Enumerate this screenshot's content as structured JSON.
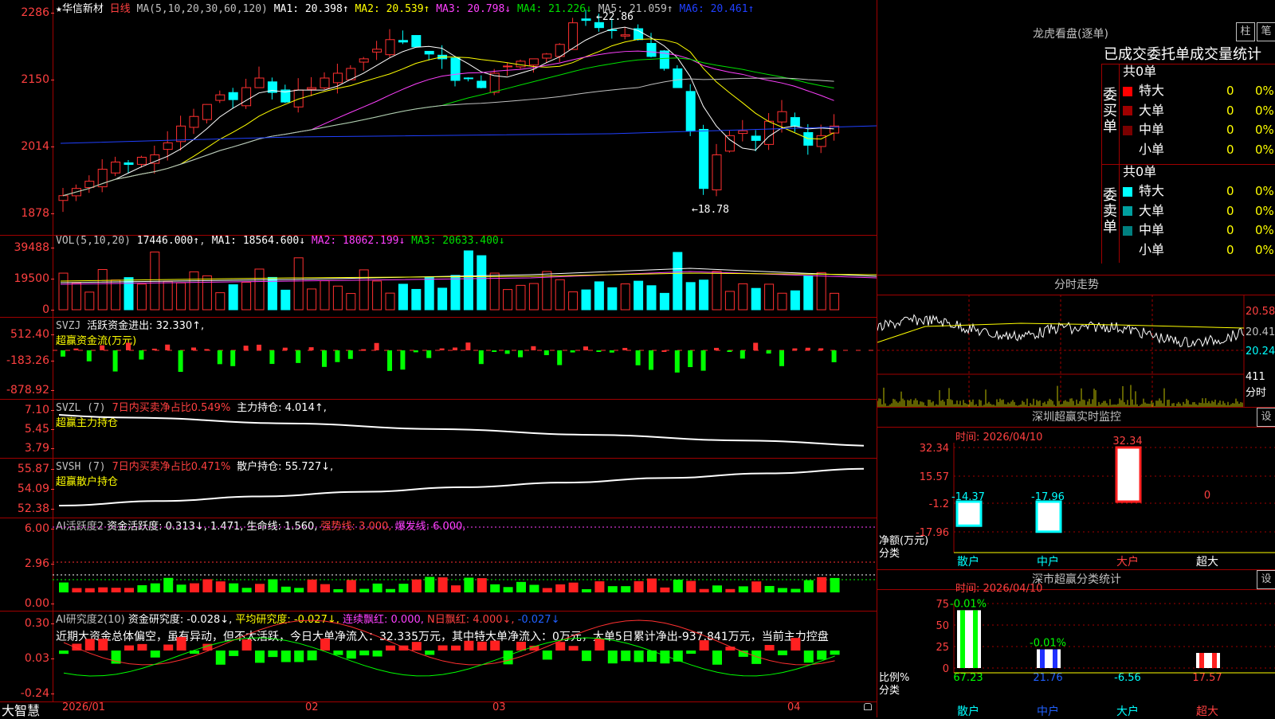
{
  "main": {
    "star": "★",
    "stock_name": "华信新材",
    "period": "日线",
    "ma_label": "MA(5,10,20,30,60,120)",
    "ma_items": [
      {
        "label": "MA1: 20.398↑",
        "color": "#ffffff"
      },
      {
        "label": "MA2: 20.539↑",
        "color": "#ffff00"
      },
      {
        "label": "MA3: 20.798↓",
        "color": "#ff40ff"
      },
      {
        "label": "MA4: 21.226↓",
        "color": "#00e000"
      },
      {
        "label": "MA5: 21.059↑",
        "color": "#c0c0c0"
      },
      {
        "label": "MA6: 20.461↑",
        "color": "#2040ff"
      }
    ],
    "y_labels": [
      "2286",
      "2150",
      "2014",
      "1878"
    ],
    "high_label": "22.86",
    "low_label": "18.78",
    "colors": {
      "up": "#ff3030",
      "down": "#00ffff"
    }
  },
  "vol": {
    "title": "VOL(5,10,20)",
    "value": "17446.000↑",
    "items": [
      {
        "label": "MA1: 18564.600↓",
        "color": "#ffffff"
      },
      {
        "label": "MA2: 18062.199↓",
        "color": "#ff40ff"
      },
      {
        "label": "MA3: 20633.400↓",
        "color": "#00e000"
      }
    ],
    "y_labels": [
      "39488",
      "19500",
      "0"
    ]
  },
  "svzj": {
    "title": "SVZJ",
    "line1": "活跃资金进出: 32.330↑,",
    "line2": "超赢资金流(万元)",
    "y_labels": [
      "512.40",
      "-183.26",
      "-878.92"
    ]
  },
  "svzl": {
    "title": "SVZL (7)",
    "t1": "7日内买卖净占比0.549%",
    "t2": "主力持仓: 4.014↑,",
    "line2": "超赢主力持仓",
    "y_labels": [
      "7.10",
      "5.45",
      "3.79"
    ]
  },
  "svsh": {
    "title": "SVSH (7)",
    "t1": "7日内买卖净占比0.471%",
    "t2": "散户持仓: 55.727↓,",
    "line2": "超赢散户持仓",
    "y_labels": [
      "55.87",
      "54.09",
      "52.38"
    ]
  },
  "ai1": {
    "title": "AI活跃度2",
    "t1": "资金活跃度: 0.313↓, 1.471,",
    "t2": "生命线: 1.560,",
    "t3": "强势线: 3.000,",
    "t4": "爆发线: 6.000,",
    "y_labels": [
      "6.00",
      "2.96",
      "0.00"
    ]
  },
  "ai2": {
    "title": "AI研究度2(10)",
    "t1": "资金研究度: -0.028↓,",
    "t2": "平均研究度: -0.027↓,",
    "t3": "连续飘红: 0.000,",
    "t4": "N日飘红: 4.000↓,",
    "t5": "-0.027↓",
    "comment": "近期大资金总体偏空，虽有异动，但不太活跃，今日大单净流入：32.335万元，其中特大单净流入：0万元，大单5日累计净出-937.841万元，当前主力控盘",
    "y_labels": [
      "0.30",
      "0.03",
      "-0.24"
    ]
  },
  "bottom": {
    "brand": "大智慧",
    "dates": [
      "2026/01",
      "02",
      "03",
      "04"
    ]
  },
  "dragon": {
    "title": "龙虎看盘(逐单)",
    "btn1": "柱",
    "btn2": "笔",
    "subtitle": "已成交委托单成交量统计",
    "buy_label": "委买单",
    "sell_label": "委卖单",
    "buy_total": "共0单",
    "sell_total": "共0单",
    "buy_rows": [
      {
        "name": "特大",
        "v": "0",
        "p": "0%",
        "color": "#ff0000"
      },
      {
        "name": "大单",
        "v": "0",
        "p": "0%",
        "color": "#a00000"
      },
      {
        "name": "中单",
        "v": "0",
        "p": "0%",
        "color": "#7a0000"
      },
      {
        "name": "小单",
        "v": "0",
        "p": "0%",
        "color": "#000000"
      }
    ],
    "sell_rows": [
      {
        "name": "特大",
        "v": "0",
        "p": "0%",
        "color": "#00ffff"
      },
      {
        "name": "大单",
        "v": "0",
        "p": "0%",
        "color": "#00a0a0"
      },
      {
        "name": "中单",
        "v": "0",
        "p": "0%",
        "color": "#008080"
      },
      {
        "name": "小单",
        "v": "0",
        "p": "0%",
        "color": "#000000"
      }
    ]
  },
  "intraday": {
    "title": "分时走势",
    "labels": [
      "20.58",
      "20.41",
      "20.24"
    ],
    "vol_label": "411",
    "sub_label": "分时"
  },
  "monitor": {
    "title": "深圳超赢实时监控",
    "btn": "设",
    "date": "时间: 2026/04/10",
    "y_labels": [
      "32.34",
      "15.57",
      "-1.2",
      "-17.96"
    ],
    "bar_labels": [
      "-14.37",
      "-17.96",
      "32.34",
      "0"
    ],
    "categories": [
      "散户",
      "中户",
      "大户",
      "超大"
    ],
    "unit": "净额(万元)",
    "cat_label": "分类"
  },
  "classify": {
    "title": "深市超赢分类统计",
    "btn": "设",
    "date": "时间: 2026/04/10",
    "y_labels": [
      "75",
      "50",
      "25",
      "0"
    ],
    "top_labels": [
      "-0.01%",
      "-0.01%"
    ],
    "bottom_values": [
      "67.23",
      "21.76",
      "-6.56",
      "17.57"
    ],
    "categories": [
      "散户",
      "中户",
      "大户",
      "超大"
    ],
    "unit": "比例%",
    "cat_label": "分类"
  }
}
